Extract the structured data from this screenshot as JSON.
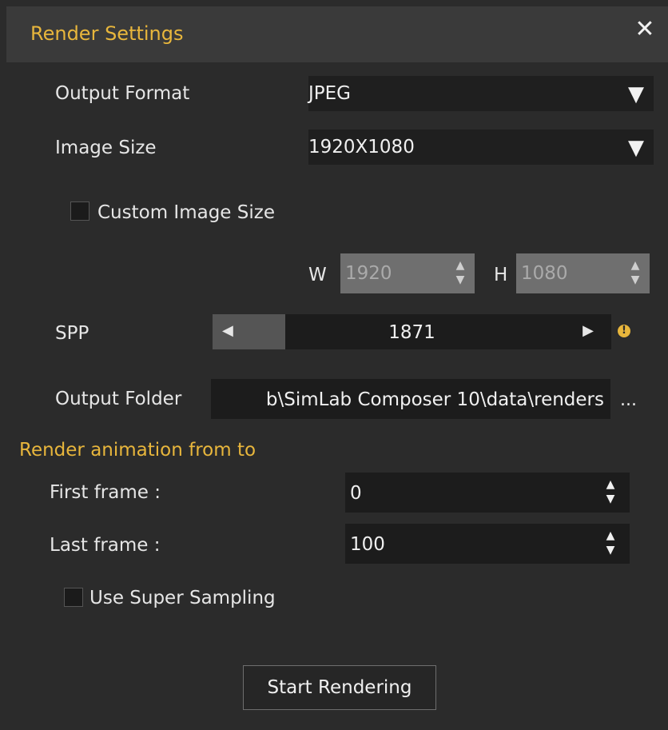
{
  "window": {
    "title": "Render Settings",
    "close_glyph": "✕"
  },
  "output_format": {
    "label": "Output Format",
    "value": "JPEG"
  },
  "image_size": {
    "label": "Image Size",
    "value": "1920X1080"
  },
  "custom_image_size": {
    "label": "Custom Image Size",
    "checked": false
  },
  "dimensions": {
    "w_label": "W",
    "w_value": "1920",
    "h_label": "H",
    "h_value": "1080"
  },
  "spp": {
    "label": "SPP",
    "value": "1871",
    "info_glyph": "!"
  },
  "output_folder": {
    "label": "Output Folder",
    "value": "b\\SimLab Composer 10\\data\\renders",
    "browse_label": "..."
  },
  "animation": {
    "section_title": "Render animation from to",
    "first_frame_label": "First frame :",
    "first_frame_value": "0",
    "last_frame_label": "Last frame :",
    "last_frame_value": "100"
  },
  "super_sampling": {
    "label": "Use Super Sampling",
    "checked": false
  },
  "start_button": {
    "label": "Start Rendering"
  },
  "colors": {
    "accent": "#e8b63c",
    "background": "#2b2b2b",
    "titlebar": "#3a3a3a"
  }
}
